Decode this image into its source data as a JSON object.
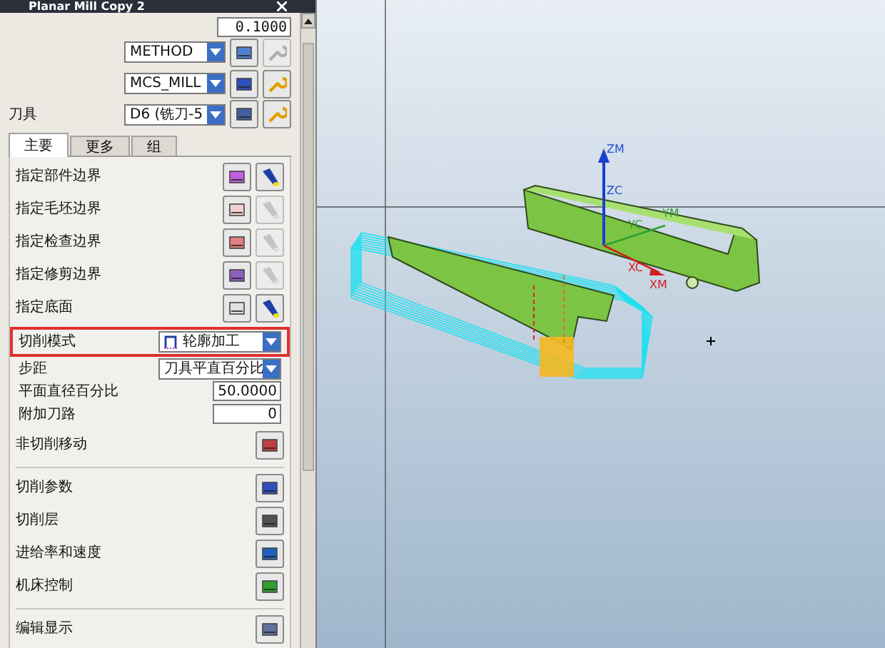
{
  "window": {
    "title": "Planar Mill Copy 2"
  },
  "tolerance": {
    "value": "0.1000"
  },
  "selectors": [
    {
      "value": "METHOD"
    },
    {
      "value": "MCS_MILL"
    },
    {
      "label": "刀具",
      "value": "D6 (铣刀-5"
    }
  ],
  "tabs": [
    {
      "label": "主要",
      "selected": true
    },
    {
      "label": "更多",
      "selected": false
    },
    {
      "label": "组",
      "selected": false
    }
  ],
  "geometry": [
    {
      "label": "指定部件边界",
      "display_enabled": true
    },
    {
      "label": "指定毛坯边界",
      "display_enabled": false
    },
    {
      "label": "指定检查边界",
      "display_enabled": false
    },
    {
      "label": "指定修剪边界",
      "display_enabled": false
    },
    {
      "label": "指定底面",
      "display_enabled": true
    }
  ],
  "settings": [
    {
      "kind": "dropdown",
      "label": "切削模式",
      "value": "轮廓加工",
      "highlighted": true
    },
    {
      "kind": "dropdown",
      "label": "步距",
      "value": "刀具平直百分比",
      "highlighted": false
    },
    {
      "kind": "field",
      "label": "平面直径百分比",
      "value": "50.0000",
      "highlighted": false
    },
    {
      "kind": "field",
      "label": "附加刀路",
      "value": "0",
      "highlighted": false
    }
  ],
  "actions": [
    [
      {
        "label": "非切削移动"
      }
    ],
    [
      {
        "label": "切削参数"
      },
      {
        "label": "切削层"
      },
      {
        "label": "进给率和速度"
      },
      {
        "label": "机床控制"
      }
    ],
    [
      {
        "label": "编辑显示"
      }
    ]
  ],
  "viewport": {
    "axis_labels": [
      "ZM",
      "ZC",
      "YM",
      "YC",
      "XM",
      "XC"
    ]
  }
}
